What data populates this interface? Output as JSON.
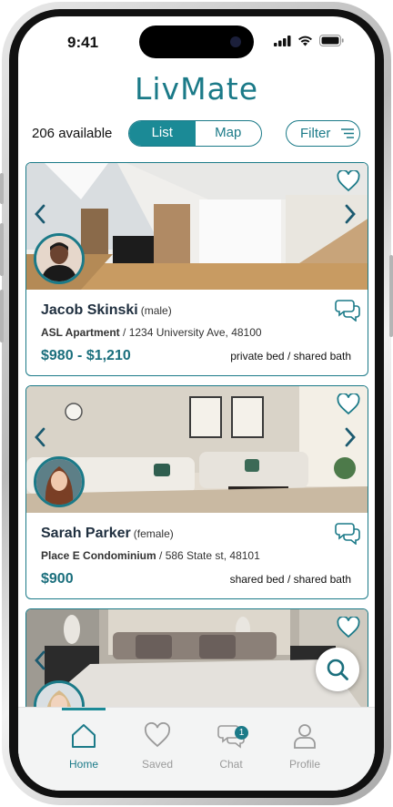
{
  "status_bar": {
    "time": "9:41"
  },
  "app": {
    "logo_text": "LivMate",
    "brand_color": "#1b7a88"
  },
  "toolbar": {
    "available": "206 available",
    "view_list": "List",
    "view_map": "Map",
    "filter": "Filter"
  },
  "listings": [
    {
      "name": "Jacob Skinski",
      "gender": "(male)",
      "building": "ASL Apartment",
      "address": " / 1234 University Ave, 48100",
      "price": "$980 - $1,210",
      "room": "private bed / shared bath"
    },
    {
      "name": "Sarah Parker",
      "gender": "(female)",
      "building": "Place E Condominium",
      "address": " / 586 State st, 48101",
      "price": "$900",
      "room": "shared bed / shared bath"
    }
  ],
  "nav": {
    "home": "Home",
    "saved": "Saved",
    "chat": "Chat",
    "profile": "Profile",
    "chat_badge": "1"
  }
}
